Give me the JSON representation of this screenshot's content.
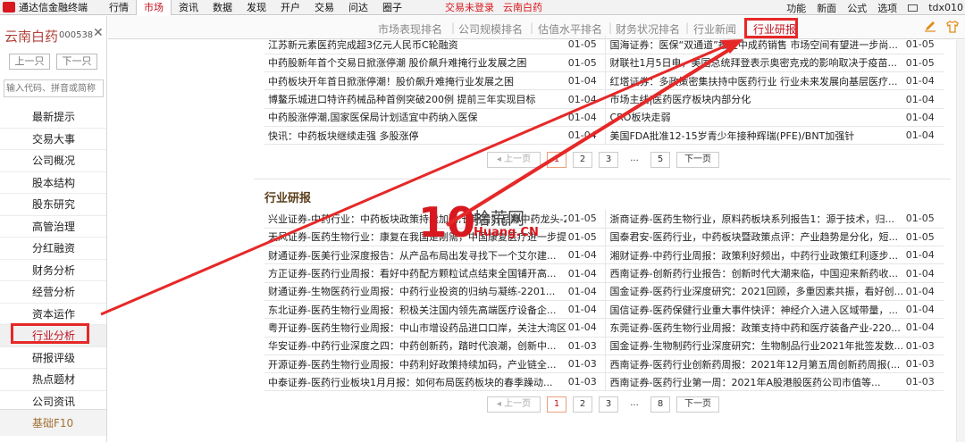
{
  "menubar": {
    "app_title": "通达信金融终端",
    "items": [
      "行情",
      "市场",
      "资讯",
      "数据",
      "发现",
      "开户",
      "交易",
      "问达",
      "圈子"
    ],
    "active_index": 1,
    "status_text": "交易未登录",
    "stock": "云南白药",
    "right_items": [
      "功能",
      "新面",
      "公式",
      "选项",
      "tdx010"
    ]
  },
  "sidebar": {
    "stock_name": "云南白药",
    "stock_code": "000538",
    "prev_label": "上一只",
    "next_label": "下一只",
    "search_placeholder": "输入代码、拼音或简称",
    "items": [
      "最新提示",
      "交易大事",
      "公司概况",
      "股本结构",
      "股东研究",
      "高管治理",
      "分红融资",
      "财务分析",
      "经营分析",
      "资本运作",
      "行业分析",
      "研报评级",
      "热点题材",
      "公司资讯"
    ],
    "active_index": 10,
    "bottom_label": "基础F10"
  },
  "tabs": {
    "items": [
      "市场表现排名",
      "公司规模排名",
      "估值水平排名",
      "财务状况排名",
      "行业新闻",
      "行业研报"
    ],
    "active_index": 5
  },
  "news": {
    "rows": [
      [
        "江苏新元素医药完成超3亿元人民币C轮融资",
        "01-05",
        "国海证券：医保“双通道”推进中成药销售 市场空间有望进一步尚...",
        "01-05"
      ],
      [
        "中药股新年首个交易日掀涨停潮 股价飙升难掩行业发展之困",
        "01-05",
        "财联社1月5日电，美国总统拜登表示奥密克戎的影响取决于疫苗...",
        "01-05"
      ],
      [
        "中药板块开年首日掀涨停潮！股价飙升难掩行业发展之困",
        "01-04",
        "红塔证券：多政策密集扶持中医药行业 行业未来发展向基层医疗...",
        "01-04"
      ],
      [
        "博鳌乐城进口特许药械品种首例突破200例 提前三年实现目标",
        "01-04",
        "市场主线|医药医疗板块内部分化",
        "01-04"
      ],
      [
        "中药股涨停潮,国家医保局计划适宜中药纳入医保",
        "01-04",
        "CRO板块走弱",
        "01-04"
      ],
      [
        "快讯：中药板块继续走强 多股涨停",
        "01-04",
        "美国FDA批准12-15岁青少年接种辉瑞(PFE)/BNT加强针",
        "01-04"
      ]
    ],
    "pager": {
      "prev": "上一页",
      "pages": [
        "1",
        "2",
        "3",
        "...",
        "5"
      ],
      "active": "1",
      "next": "下一页"
    }
  },
  "research": {
    "title": "行业研报",
    "rows": [
      [
        "兴业证券-中药行业：中药板块政策持续加码,长期看好品牌中药龙头-220...",
        "01-05",
        "浙商证券-医药生物行业，原料药板块系列报告1：源于技术，归...",
        "01-05"
      ],
      [
        "天风证券-医药生物行业：康复在我国是刚需，中国康复医疗进一步提...",
        "01-05",
        "国泰君安-医药行业，中药板块暨政策点评：产业趋势是分化，短...",
        "01-05"
      ],
      [
        "财通证券-医美行业深度报告：从产品布局出发寻找下一个艾尔建...",
        "01-04",
        "湘财证券-中药行业周报：政策利好频出，中药行业政策红利逐步...",
        "01-04"
      ],
      [
        "方正证券-医药行业周报：看好中药配方颗粒试点结束全国铺开高...",
        "01-04",
        "西南证券-创新药行业报告：创新时代大潮来临，中国迎来新药收...",
        "01-04"
      ],
      [
        "财通证券-生物医药行业周报：中药行业投资的归纳与凝练-2201...",
        "01-04",
        "国金证券-医药行业深度研究：2021回顾，多重因素共振，看好创...",
        "01-04"
      ],
      [
        "东北证券-医药生物行业周报：积极关注国内领先高端医疗设备企...",
        "01-04",
        "国信证券-医药保健行业重大事件快评：神经介入进入区域带量，...",
        "01-04"
      ],
      [
        "粤开证券-医药生物行业周报：中山市增设药品进口口岸，关注大湾区...",
        "01-04",
        "东莞证券-医药生物行业周报：政策支持中药和医疗装备产业-220...",
        "01-04"
      ],
      [
        "华安证券-中药行业深度之四：中药创新药，踏时代浪潮，创新中...",
        "01-03",
        "国金证券-生物制药行业深度研究：生物制品行业2021年批签发数...",
        "01-03"
      ],
      [
        "开源证券-医药生物行业周报：中药利好政策持续加码，产业链全...",
        "01-03",
        "西南证券-医药行业创新药周报：2021年12月第五周创新药周报(...",
        "01-03"
      ],
      [
        "中泰证券-医药行业板块1月月报：如何布局医药板块的春季躁动...",
        "01-03",
        "西南证券-医药行业第一周：2021年A股港股医药公司市值等...",
        "01-03"
      ]
    ],
    "pager": {
      "prev": "上一页",
      "pages": [
        "1",
        "2",
        "3",
        "...",
        "8"
      ],
      "active": "1",
      "next": "下一页"
    }
  },
  "watermark": {
    "cn": "拾荒网",
    "en": "Huang.CN",
    "num": "10"
  },
  "colors": {
    "accent": "#c1121f",
    "highlight": "#e62828"
  }
}
